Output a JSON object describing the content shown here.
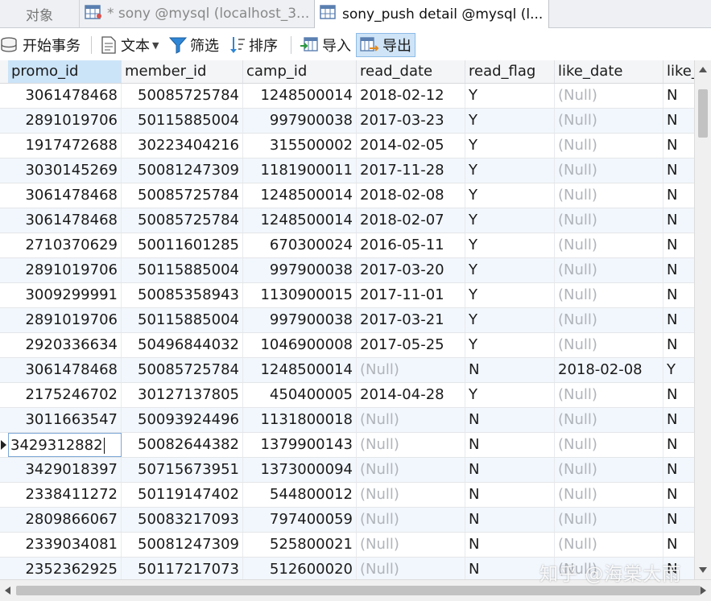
{
  "tabs": {
    "objects": "对象",
    "tab1": "* sony @mysql (localhost_3...",
    "tab2": "sony_push detail @mysql (l..."
  },
  "toolbar": {
    "begin_transaction": "开始事务",
    "text": "文本",
    "filter": "筛选",
    "sort": "排序",
    "import": "导入",
    "export": "导出"
  },
  "columns": [
    "promo_id",
    "member_id",
    "camp_id",
    "read_date",
    "read_flag",
    "like_date",
    "like_"
  ],
  "null_label": "(Null)",
  "rows": [
    [
      "3061478468",
      "50085725784",
      "1248500014",
      "2018-02-12",
      "Y",
      "(Null)",
      "N"
    ],
    [
      "2891019706",
      "50115885004",
      "997900038",
      "2017-03-23",
      "Y",
      "(Null)",
      "N"
    ],
    [
      "1917472688",
      "30223404216",
      "315500002",
      "2014-02-05",
      "Y",
      "(Null)",
      "N"
    ],
    [
      "3030145269",
      "50081247309",
      "1181900011",
      "2017-11-28",
      "Y",
      "(Null)",
      "N"
    ],
    [
      "3061478468",
      "50085725784",
      "1248500014",
      "2018-02-08",
      "Y",
      "(Null)",
      "N"
    ],
    [
      "3061478468",
      "50085725784",
      "1248500014",
      "2018-02-07",
      "Y",
      "(Null)",
      "N"
    ],
    [
      "2710370629",
      "50011601285",
      "670300024",
      "2016-05-11",
      "Y",
      "(Null)",
      "N"
    ],
    [
      "2891019706",
      "50115885004",
      "997900038",
      "2017-03-20",
      "Y",
      "(Null)",
      "N"
    ],
    [
      "3009299991",
      "50085358943",
      "1130900015",
      "2017-11-01",
      "Y",
      "(Null)",
      "N"
    ],
    [
      "2891019706",
      "50115885004",
      "997900038",
      "2017-03-21",
      "Y",
      "(Null)",
      "N"
    ],
    [
      "2920336634",
      "50496844032",
      "1046900008",
      "2017-05-25",
      "Y",
      "(Null)",
      "N"
    ],
    [
      "3061478468",
      "50085725784",
      "1248500014",
      "(Null)",
      "N",
      "2018-02-08",
      "Y"
    ],
    [
      "2175246702",
      "30127137805",
      "450400005",
      "2014-04-28",
      "Y",
      "(Null)",
      "N"
    ],
    [
      "3011663547",
      "50093924496",
      "1131800018",
      "(Null)",
      "N",
      "(Null)",
      "N"
    ],
    [
      "3429312882",
      "50082644382",
      "1379900143",
      "(Null)",
      "N",
      "(Null)",
      "N"
    ],
    [
      "3429018397",
      "50715673951",
      "1373000094",
      "(Null)",
      "N",
      "(Null)",
      "N"
    ],
    [
      "2338411272",
      "50119147402",
      "544800012",
      "(Null)",
      "N",
      "(Null)",
      "N"
    ],
    [
      "2809866067",
      "50083217093",
      "797400059",
      "(Null)",
      "N",
      "(Null)",
      "N"
    ],
    [
      "2339034081",
      "50081247309",
      "525800021",
      "(Null)",
      "N",
      "(Null)",
      "N"
    ],
    [
      "2352362925",
      "50117217073",
      "512600020",
      "(Null)",
      "N",
      "(Null)",
      "N"
    ]
  ],
  "current_row": 14,
  "watermark": "知乎 @海棠大雨",
  "colors": {
    "selected_header": "#cce4f8",
    "alt_row": "#f2f7fd",
    "null_text": "#b0b4ba"
  }
}
